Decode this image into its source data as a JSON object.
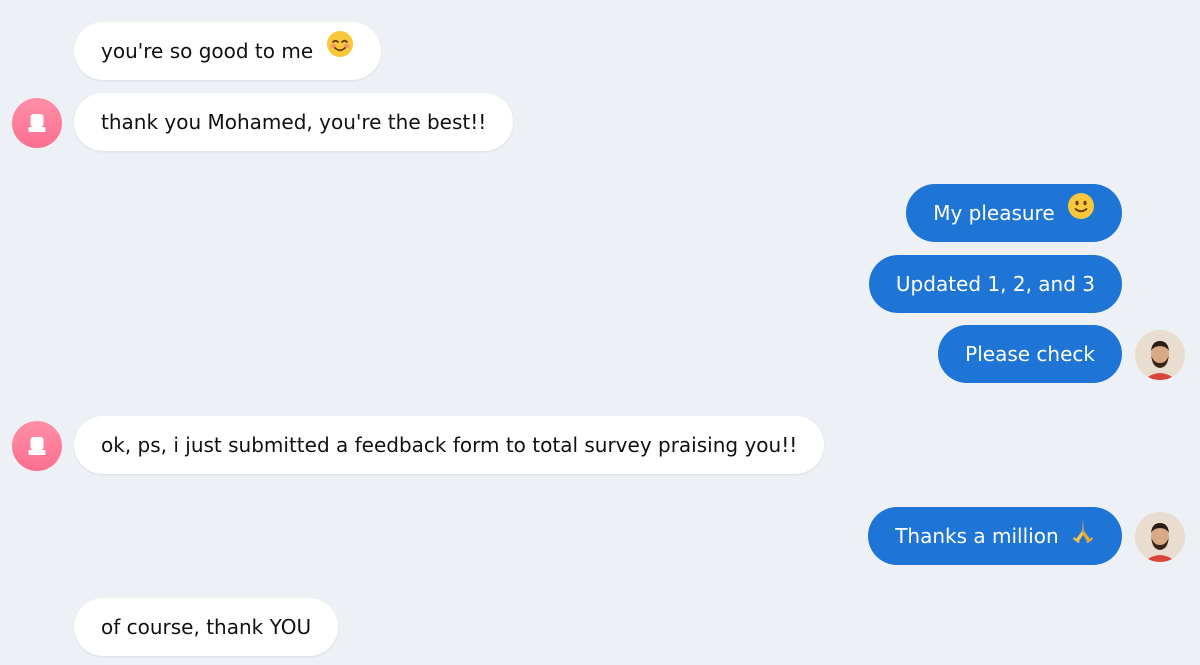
{
  "conversation": {
    "contact_avatar_icon": "user-icon",
    "self_avatar_icon": "user-photo",
    "messages": [
      {
        "direction": "incoming",
        "text": "you're so good to me",
        "emoji": "smiling-face-with-blush-emoji"
      },
      {
        "direction": "incoming",
        "text": "thank you Mohamed, you're the best!!"
      },
      {
        "direction": "outgoing",
        "text": "My pleasure",
        "emoji": "slightly-smiling-face-emoji"
      },
      {
        "direction": "outgoing",
        "text": "Updated 1, 2, and 3"
      },
      {
        "direction": "outgoing",
        "text": "Please check"
      },
      {
        "direction": "incoming",
        "text": "ok, ps, i just submitted a feedback form to total survey praising you!!"
      },
      {
        "direction": "outgoing",
        "text": "Thanks a million",
        "emoji": "folded-hands-emoji"
      },
      {
        "direction": "incoming",
        "text": "of course, thank YOU"
      }
    ]
  },
  "colors": {
    "background": "#edf0f4",
    "incoming_bubble": "#ffffff",
    "outgoing_bubble": "#1f75d6",
    "contact_avatar": "#fb6f90"
  }
}
